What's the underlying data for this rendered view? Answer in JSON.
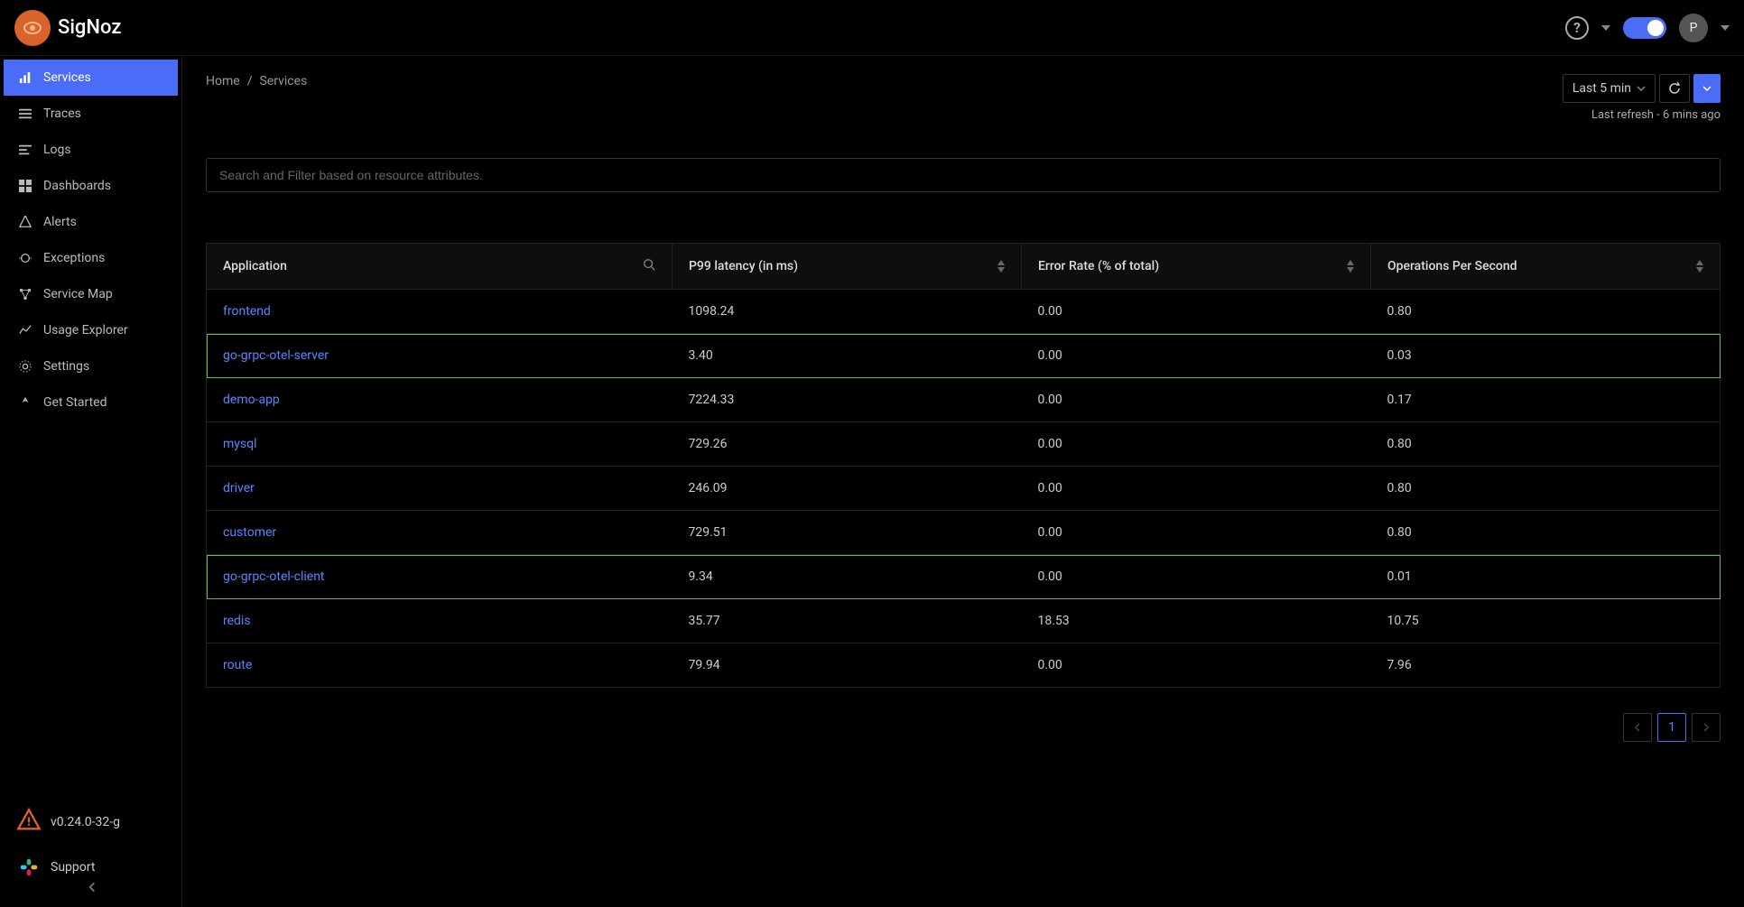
{
  "brand": {
    "name": "SigNoz"
  },
  "topbar": {
    "avatarInitial": "P"
  },
  "sidebar": {
    "items": [
      {
        "label": "Services",
        "active": true
      },
      {
        "label": "Traces"
      },
      {
        "label": "Logs"
      },
      {
        "label": "Dashboards"
      },
      {
        "label": "Alerts"
      },
      {
        "label": "Exceptions"
      },
      {
        "label": "Service Map"
      },
      {
        "label": "Usage Explorer"
      },
      {
        "label": "Settings"
      },
      {
        "label": "Get Started"
      }
    ],
    "version": "v0.24.0-32-g",
    "support": "Support"
  },
  "breadcrumb": {
    "home": "Home",
    "sep": "/",
    "current": "Services"
  },
  "timeRange": {
    "label": "Last 5 min",
    "refreshText": "Last refresh - 6 mins ago"
  },
  "search": {
    "placeholder": "Search and Filter based on resource attributes."
  },
  "tableHeaders": {
    "application": "Application",
    "p99": "P99 latency (in ms)",
    "errorRate": "Error Rate (% of total)",
    "ops": "Operations Per Second"
  },
  "rows": [
    {
      "app": "frontend",
      "p99": "1098.24",
      "err": "0.00",
      "ops": "0.80",
      "hl": false
    },
    {
      "app": "go-grpc-otel-server",
      "p99": "3.40",
      "err": "0.00",
      "ops": "0.03",
      "hl": true
    },
    {
      "app": "demo-app",
      "p99": "7224.33",
      "err": "0.00",
      "ops": "0.17",
      "hl": false
    },
    {
      "app": "mysql",
      "p99": "729.26",
      "err": "0.00",
      "ops": "0.80",
      "hl": false
    },
    {
      "app": "driver",
      "p99": "246.09",
      "err": "0.00",
      "ops": "0.80",
      "hl": false
    },
    {
      "app": "customer",
      "p99": "729.51",
      "err": "0.00",
      "ops": "0.80",
      "hl": false
    },
    {
      "app": "go-grpc-otel-client",
      "p99": "9.34",
      "err": "0.00",
      "ops": "0.01",
      "hl": true
    },
    {
      "app": "redis",
      "p99": "35.77",
      "err": "18.53",
      "ops": "10.75",
      "hl": false
    },
    {
      "app": "route",
      "p99": "79.94",
      "err": "0.00",
      "ops": "7.96",
      "hl": false
    }
  ],
  "pagination": {
    "page": "1"
  }
}
